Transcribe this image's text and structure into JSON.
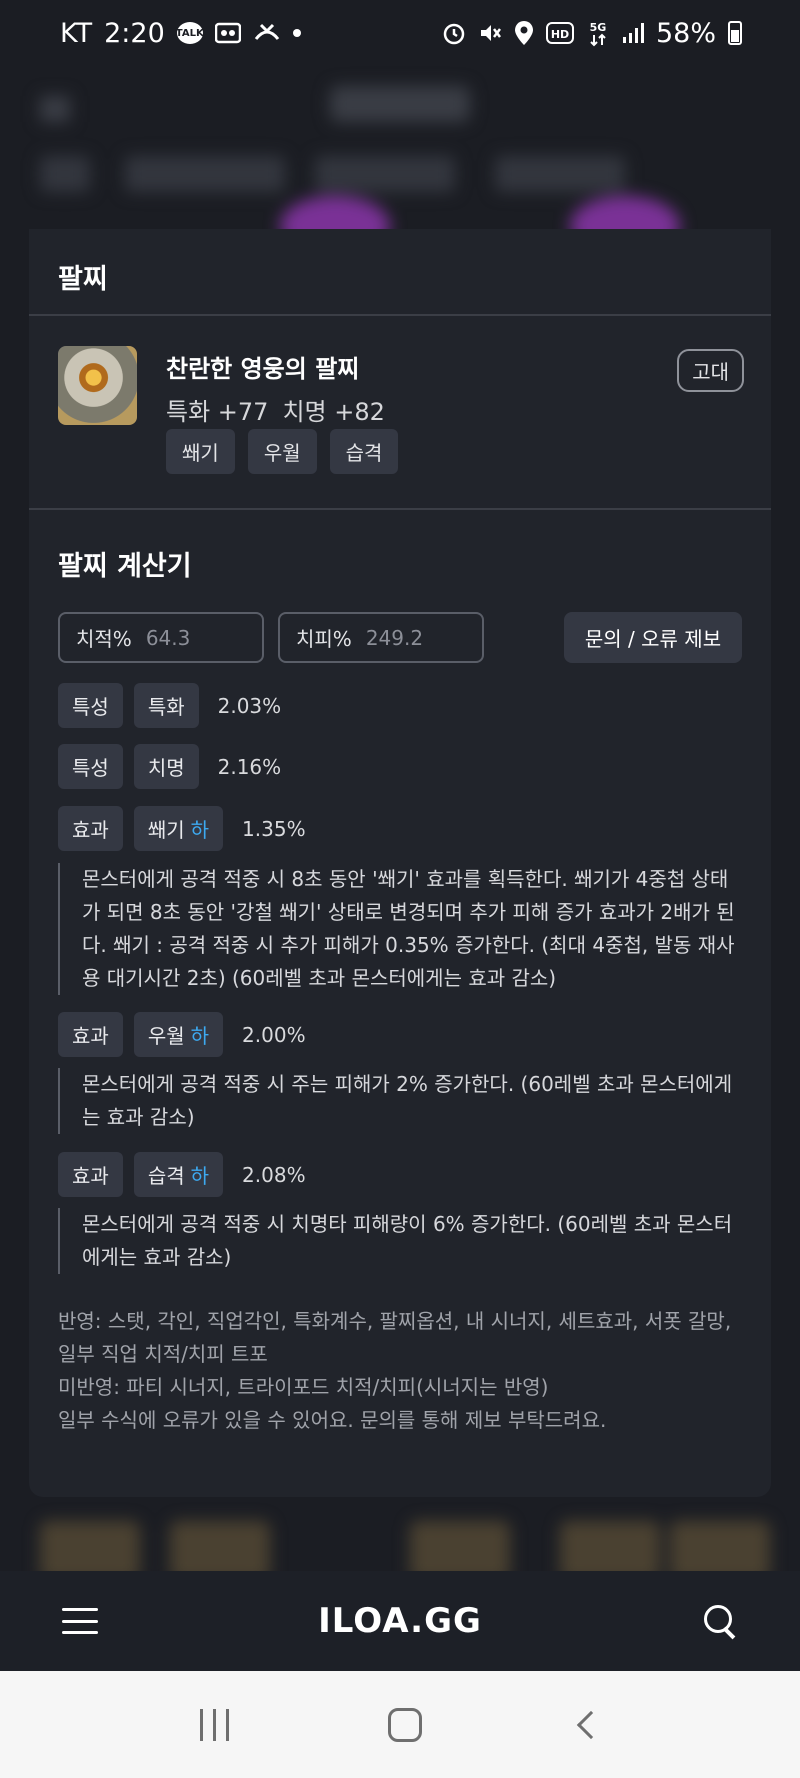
{
  "status_bar": {
    "carrier": "KT",
    "time": "2:20",
    "talk_label": "TALK",
    "battery": "58%"
  },
  "modal": {
    "title": "팔찌",
    "item": {
      "name": "찬란한 영웅의 팔찌",
      "stats": [
        "특화 +77",
        "치명 +82"
      ],
      "tags": [
        "쐐기",
        "우월",
        "습격"
      ],
      "grade": "고대"
    },
    "calculator": {
      "title": "팔찌 계산기",
      "crit_rate_label": "치적%",
      "crit_rate_value": "64.3",
      "crit_dmg_label": "치피%",
      "crit_dmg_value": "249.2",
      "report_button": "문의 / 오류 제보",
      "rows": [
        {
          "type": "특성",
          "name": "특화",
          "level": "",
          "value": "2.03%"
        },
        {
          "type": "특성",
          "name": "치명",
          "level": "",
          "value": "2.16%"
        },
        {
          "type": "효과",
          "name": "쐐기",
          "level": "하",
          "value": "1.35%",
          "desc": "몬스터에게 공격 적중 시 8초 동안 '쐐기' 효과를 획득한다. 쐐기가 4중첩 상태가 되면 8초 동안 '강철 쐐기' 상태로 변경되며 추가 피해 증가 효과가 2배가 된다. 쐐기 : 공격 적중 시 추가 피해가 0.35% 증가한다. (최대 4중첩, 발동 재사용 대기시간 2초) (60레벨 초과 몬스터에게는 효과 감소)"
        },
        {
          "type": "효과",
          "name": "우월",
          "level": "하",
          "value": "2.00%",
          "desc": "몬스터에게 공격 적중 시 주는 피해가 2% 증가한다. (60레벨 초과 몬스터에게는 효과 감소)"
        },
        {
          "type": "효과",
          "name": "습격",
          "level": "하",
          "value": "2.08%",
          "desc": "몬스터에게 공격 적중 시 치명타 피해량이 6% 증가한다. (60레벨 초과 몬스터에게는 효과 감소)"
        }
      ],
      "notes": [
        "반영: 스탯, 각인, 직업각인, 특화계수, 팔찌옵션, 내 시너지, 세트효과, 서폿 갈망, 일부 직업 치적/치피 트포",
        "미반영: 파티 시너지, 트라이포드 치적/치피(시너지는 반영)",
        "일부 수식에 오류가 있을 수 있어요. 문의를 통해 제보 부탁드려요."
      ]
    }
  },
  "app_bar": {
    "logo": "ILOA.GG"
  }
}
